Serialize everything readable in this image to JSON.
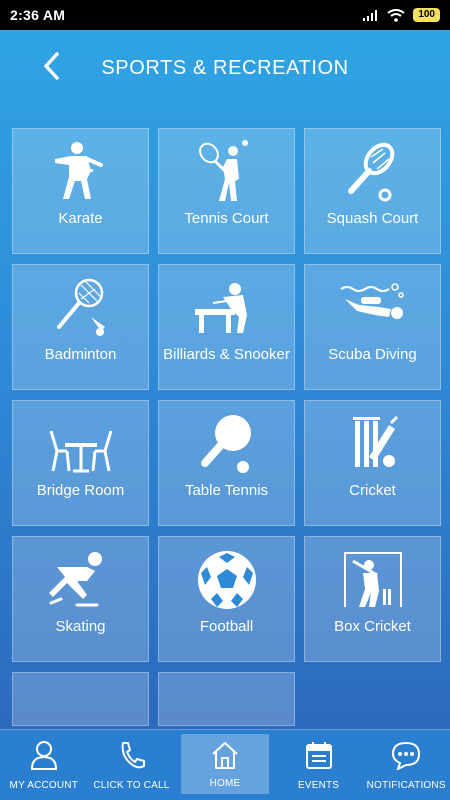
{
  "status": {
    "time": "2:36 AM",
    "battery": "100"
  },
  "header": {
    "title": "SPORTS & RECREATION"
  },
  "tiles": [
    {
      "label": "Karate",
      "icon": "karate-icon"
    },
    {
      "label": "Tennis Court",
      "icon": "tennis-icon"
    },
    {
      "label": "Squash Court",
      "icon": "squash-icon"
    },
    {
      "label": "Badminton",
      "icon": "badminton-icon"
    },
    {
      "label": "Billiards & Snooker",
      "icon": "billiards-icon"
    },
    {
      "label": "Scuba Diving",
      "icon": "scuba-icon"
    },
    {
      "label": "Bridge Room",
      "icon": "bridge-room-icon"
    },
    {
      "label": "Table Tennis",
      "icon": "table-tennis-icon"
    },
    {
      "label": "Cricket",
      "icon": "cricket-icon"
    },
    {
      "label": "Skating",
      "icon": "skating-icon"
    },
    {
      "label": "Football",
      "icon": "football-icon"
    },
    {
      "label": "Box Cricket",
      "icon": "box-cricket-icon"
    },
    {
      "label": "",
      "icon": ""
    },
    {
      "label": "",
      "icon": ""
    }
  ],
  "nav": [
    {
      "label": "MY ACCOUNT",
      "icon": "account-icon"
    },
    {
      "label": "CLICK TO CALL",
      "icon": "phone-icon"
    },
    {
      "label": "HOME",
      "icon": "home-icon",
      "active": true
    },
    {
      "label": "EVENTS",
      "icon": "calendar-icon"
    },
    {
      "label": "NOTIFICATIONS",
      "icon": "chat-icon"
    }
  ],
  "colors": {
    "accent": "#2f8ad7",
    "nav_bg": "#2a7fd1"
  }
}
